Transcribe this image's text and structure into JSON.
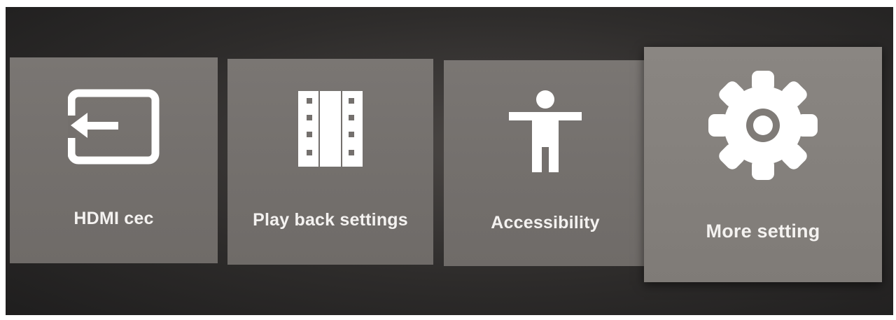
{
  "menu": {
    "tiles": [
      {
        "label": "HDMI cec",
        "icon": "input-icon"
      },
      {
        "label": "Play back settings",
        "icon": "film-icon"
      },
      {
        "label": "Accessibility",
        "icon": "accessibility-icon"
      },
      {
        "label": "More setting",
        "icon": "gear-icon",
        "focused": true
      }
    ]
  },
  "colors": {
    "tile": "#74706d",
    "tile_focused": "#837f7b",
    "text": "#f4f2f0",
    "background": "#2e2c2b"
  }
}
